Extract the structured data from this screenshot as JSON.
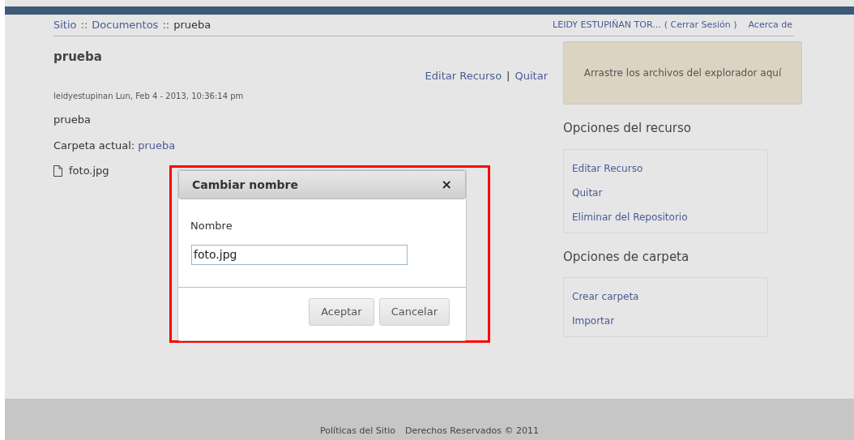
{
  "breadcrumb": [
    {
      "label": "Sitio",
      "link": true
    },
    {
      "label": "Documentos",
      "link": true
    },
    {
      "label": "prueba",
      "link": false
    }
  ],
  "breadcrumb_separator": "::",
  "user_menu": {
    "user": "LEIDY ESTUPIÑAN TOR...",
    "logout": "( Cerrar Sesión )",
    "about": "Acerca de"
  },
  "resource": {
    "title": "prueba",
    "actions": [
      "Editar Recurso",
      "Quitar"
    ],
    "action_separator": "|",
    "meta": "leidyestupinan Lun, Feb 4 - 2013, 10:36:14 pm",
    "description": "prueba",
    "folder_label": "Carpeta actual:",
    "folder": "prueba",
    "files": [
      "foto.jpg"
    ]
  },
  "drop_zone": "Arrastre los archivos del explorador aquí",
  "sections": [
    {
      "title": "Opciones del recurso",
      "links": [
        "Editar Recurso",
        "Quitar",
        "Eliminar del Repositorio"
      ]
    },
    {
      "title": "Opciones de carpeta",
      "links": [
        "Crear carpeta",
        "Importar"
      ]
    }
  ],
  "dialog": {
    "title": "Cambiar nombre",
    "close": "×",
    "field_label": "Nombre",
    "value": "foto.jpg",
    "buttons": [
      "Aceptar",
      "Cancelar"
    ]
  },
  "footer": [
    "Políticas del Sitio",
    "Derechos Reservados © 2011"
  ]
}
